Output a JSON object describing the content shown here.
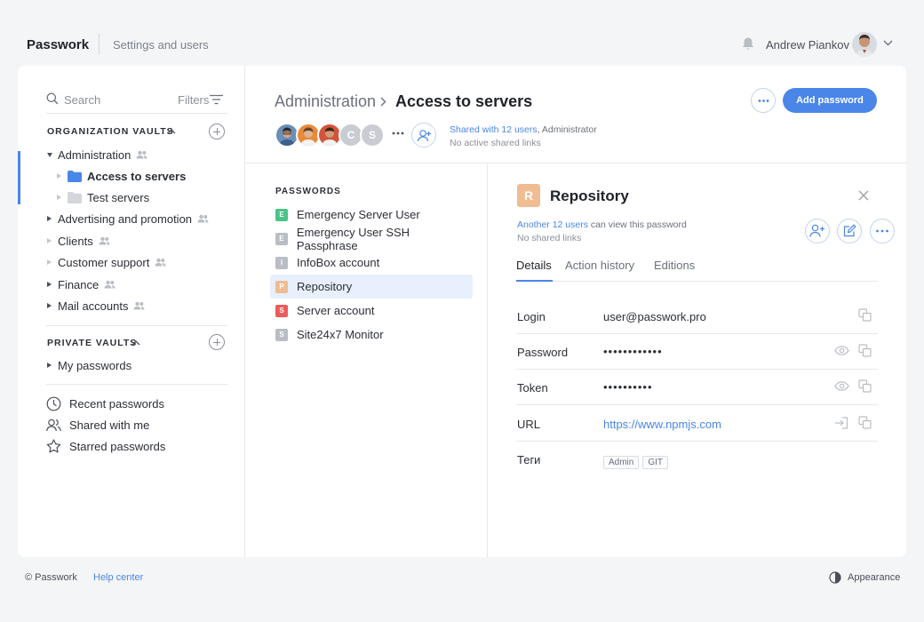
{
  "header": {
    "logo": "Passwork",
    "section": "Settings and users",
    "user_name": "Andrew Piankov"
  },
  "sidebar": {
    "search_placeholder": "Search",
    "filters_label": "Filters",
    "org_vaults_title": "ORGANIZATION VAULTS",
    "org_vaults": [
      {
        "label": "Administration",
        "expanded": true,
        "shared": true
      },
      {
        "label": "Access to servers",
        "selected": true
      },
      {
        "label": "Test servers"
      },
      {
        "label": "Advertising and promotion",
        "shared": true
      },
      {
        "label": "Clients",
        "shared": true
      },
      {
        "label": "Customer support",
        "shared": true
      },
      {
        "label": "Finance",
        "shared": true
      },
      {
        "label": "Mail accounts",
        "shared": true
      }
    ],
    "private_vaults_title": "PRIVATE VAULTS",
    "private_vaults": [
      {
        "label": "My passwords"
      }
    ],
    "nav": [
      {
        "label": "Recent passwords",
        "icon": "clock-icon"
      },
      {
        "label": "Shared with me",
        "icon": "users-icon"
      },
      {
        "label": "Starred passwords",
        "icon": "star-icon"
      }
    ]
  },
  "folder_header": {
    "parent": "Administration",
    "current": "Access to servers",
    "avatar_letters": [
      "C",
      "S"
    ],
    "shared_link": "Shared with 12 users",
    "shared_suffix": ", Administrator",
    "no_links": "No active shared links",
    "add_button": "Add password"
  },
  "passwords": {
    "title": "PASSWORDS",
    "items": [
      {
        "letter": "E",
        "label": "Emergency Server User",
        "color": "#4cc38a"
      },
      {
        "letter": "E",
        "label": "Emergency User SSH Passphrase",
        "color": "#b9bdc4"
      },
      {
        "letter": "I",
        "label": "InfoBox account",
        "color": "#b9bdc4"
      },
      {
        "letter": "P",
        "label": "Repository",
        "color": "#efbd91",
        "selected": true
      },
      {
        "letter": "S",
        "label": "Server account",
        "color": "#ec5b5b"
      },
      {
        "letter": "S",
        "label": "Site24x7 Monitor",
        "color": "#b9bdc4"
      }
    ]
  },
  "detail": {
    "letter": "R",
    "title": "Repository",
    "shared_link": "Another 12 users",
    "shared_suffix": " can view this password",
    "no_links": "No shared links",
    "tabs": [
      "Details",
      "Action history",
      "Editions"
    ],
    "fields": {
      "login_label": "Login",
      "login_value": "user@passwork.pro",
      "password_label": "Password",
      "password_value": "••••••••••••",
      "token_label": "Token",
      "token_value": "••••••••••",
      "url_label": "URL",
      "url_value": "https://www.npmjs.com",
      "tags_label": "Теги",
      "tags": [
        "Admin",
        "GIT"
      ]
    }
  },
  "footer": {
    "copyright": "© Passwork",
    "help": "Help center",
    "appearance": "Appearance"
  },
  "colors": {
    "accent": "#4a86e8",
    "background": "#f4f5f7"
  }
}
